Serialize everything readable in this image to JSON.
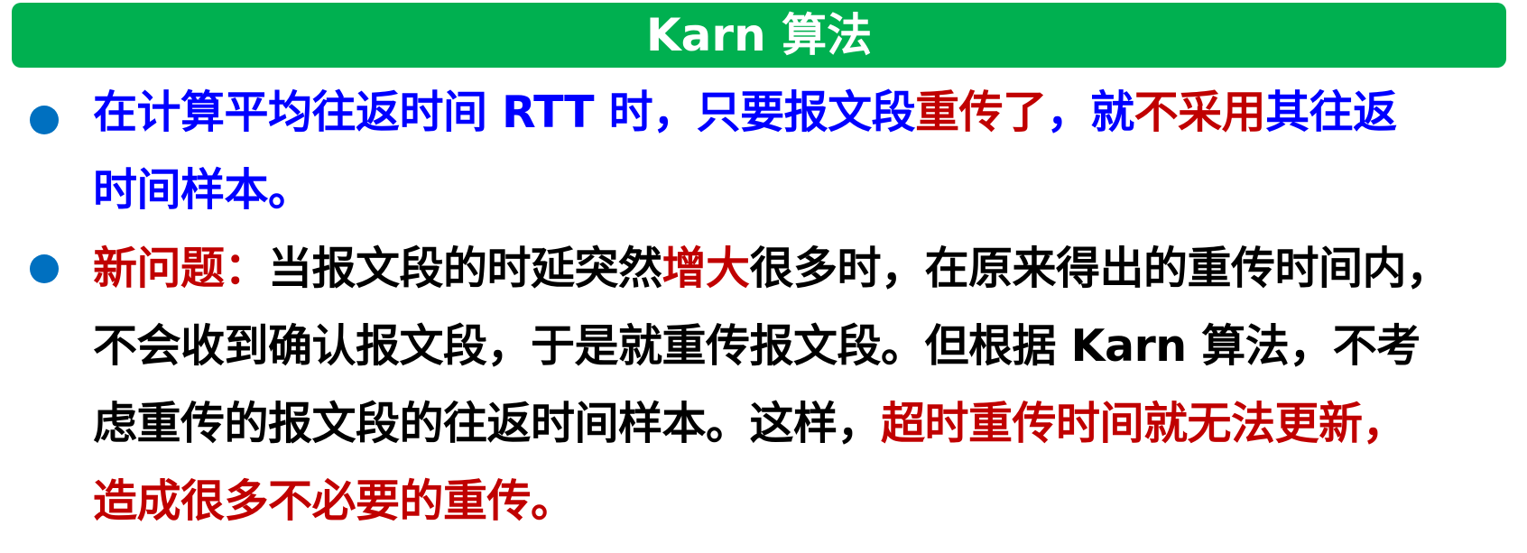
{
  "title": "Karn 算法",
  "colors": {
    "title_bg": "#00b050",
    "title_text": "#ffffff",
    "bullet": "#0070c0",
    "blue_text": "#0000ff",
    "red_text": "#c00000",
    "black_text": "#000000"
  },
  "bullets": [
    {
      "lines": [
        [
          {
            "text": "在计算平均往返时间 RTT 时，只要报文段",
            "color": "blue"
          },
          {
            "text": "重传了",
            "color": "red"
          },
          {
            "text": "，就",
            "color": "blue"
          },
          {
            "text": "不采用",
            "color": "red"
          },
          {
            "text": "其往返",
            "color": "blue"
          }
        ],
        [
          {
            "text": "时间样本。",
            "color": "blue"
          }
        ]
      ]
    },
    {
      "lines": [
        [
          {
            "text": "新问题：",
            "color": "red"
          },
          {
            "text": "当报文段的时延突然",
            "color": "black"
          },
          {
            "text": "增大",
            "color": "red"
          },
          {
            "text": "很多时，在原来得出的重传时间内，",
            "color": "black"
          }
        ],
        [
          {
            "text": "不会收到确认报文段，于是就重传报文段。但根据 Karn 算法，不考",
            "color": "black"
          }
        ],
        [
          {
            "text": "虑重传的报文段的往返时间样本。这样，",
            "color": "black"
          },
          {
            "text": "超时重传时间就无法更新，",
            "color": "red"
          }
        ],
        [
          {
            "text": "造成很多不必要的重传。",
            "color": "red"
          }
        ]
      ]
    }
  ]
}
